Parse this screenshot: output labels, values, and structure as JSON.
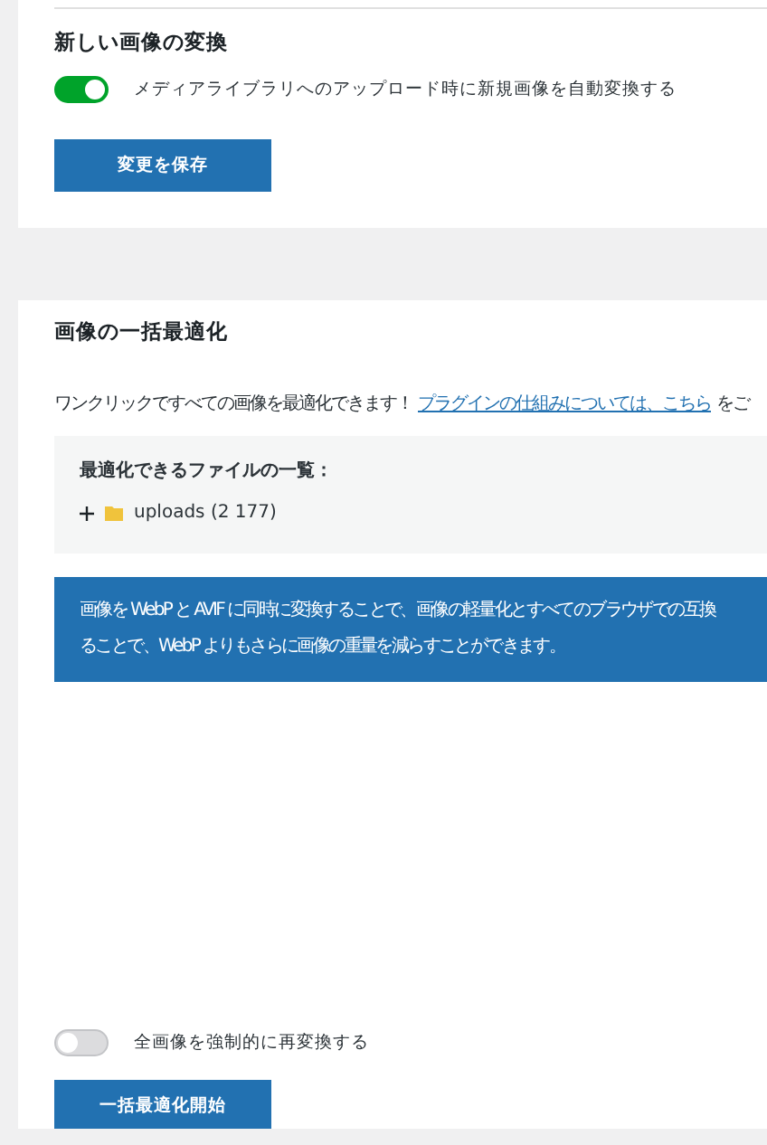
{
  "conversion_section": {
    "title": "新しい画像の変換",
    "toggle": {
      "label": "メディアライブラリへのアップロード時に新規画像を自動変換する",
      "on": true
    },
    "button": "変更を保存"
  },
  "bulk_section": {
    "title": "画像の一括最適化",
    "intro": "ワンクリックですべての画像を最適化できます！",
    "intro_link": "プラグインの仕組みについては、こちら",
    "intro_tail": "をご",
    "files": {
      "title": "最適化できるファイルの一覧：",
      "tree": [
        {
          "label": "uploads (2 177)",
          "expanded": false
        }
      ]
    },
    "notice_lines": [
      "画像を WebP と AVIF に同時に変換することで、画像の軽量化とすべてのブラウザでの互換",
      "ることで、WebP よりもさらに画像の重量を減らすことができます。"
    ],
    "toggle": {
      "label": "全画像を強制的に再変換する",
      "on": false
    },
    "button": "一括最適化開始"
  }
}
